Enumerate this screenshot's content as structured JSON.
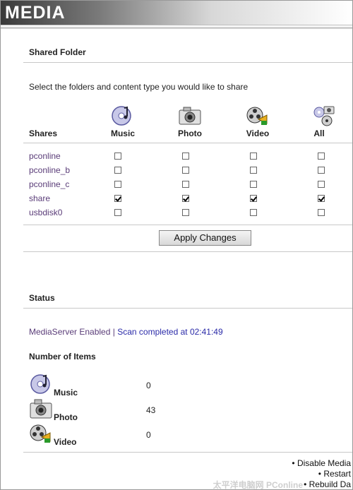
{
  "header": {
    "title": "MEDIA"
  },
  "shared_folder": {
    "heading": "Shared Folder",
    "instruction": "Select the folders and content type you would like to share",
    "shares_label": "Shares",
    "columns": [
      "Music",
      "Photo",
      "Video",
      "All"
    ],
    "rows": [
      {
        "name": "pconline",
        "checked": [
          false,
          false,
          false,
          false
        ]
      },
      {
        "name": "pconline_b",
        "checked": [
          false,
          false,
          false,
          false
        ]
      },
      {
        "name": "pconline_c",
        "checked": [
          false,
          false,
          false,
          false
        ]
      },
      {
        "name": "share",
        "checked": [
          true,
          true,
          true,
          true
        ]
      },
      {
        "name": "usbdisk0",
        "checked": [
          false,
          false,
          false,
          false
        ]
      }
    ],
    "apply_label": "Apply Changes"
  },
  "status": {
    "heading": "Status",
    "server_state": "MediaServer Enabled",
    "separator": "|",
    "scan_status": "Scan completed at 02:41:49"
  },
  "items": {
    "heading": "Number of Items",
    "list": [
      {
        "label": "Music",
        "count": "0",
        "icon": "music-cd-icon"
      },
      {
        "label": "Photo",
        "count": "43",
        "icon": "camera-icon"
      },
      {
        "label": "Video",
        "count": "0",
        "icon": "film-reel-icon"
      }
    ]
  },
  "footer": {
    "links": [
      "• Disable Media",
      "• Restart",
      "• Rebuild Da"
    ]
  },
  "watermark": "太平洋电脑网 PConline"
}
